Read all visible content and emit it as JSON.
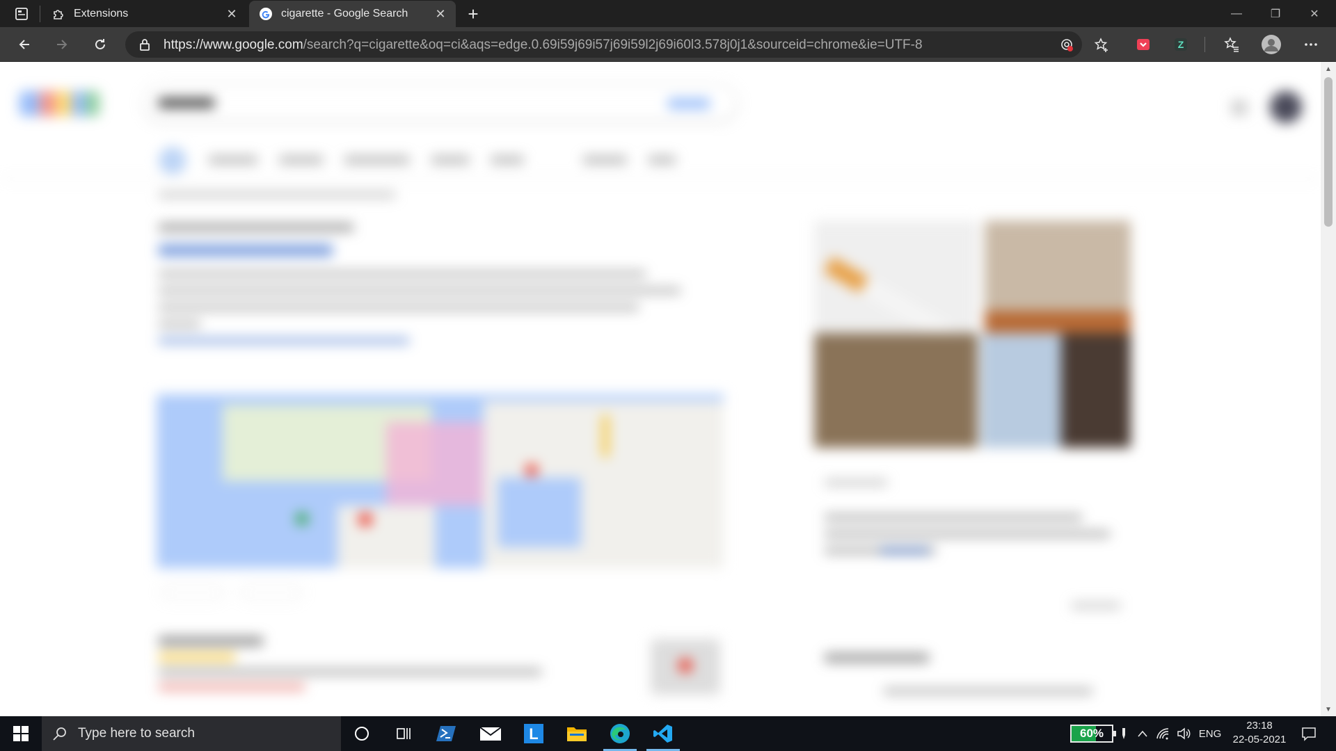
{
  "tabs": [
    {
      "title": "Extensions",
      "icon": "puzzle-icon",
      "active": false
    },
    {
      "title": "cigarette - Google Search",
      "icon": "google-g-icon",
      "active": true
    }
  ],
  "omnibox": {
    "url_host": "https://www.google.com",
    "url_path": "/search?q=cigarette&oq=ci&aqs=edge.0.69i59j69i57j69i59l2j69i60l3.578j0j1&sourceid=chrome&ie=UTF-8"
  },
  "taskbar": {
    "search_placeholder": "Type here to search",
    "battery_level": 60,
    "battery_label": "60%",
    "language": "ENG",
    "time": "23:18",
    "date": "22-05-2021",
    "pinned_apps": [
      "cortana-icon",
      "task-view-icon",
      "powershell-icon",
      "mail-icon",
      "l-app-icon",
      "file-explorer-icon",
      "edge-icon",
      "vscode-icon"
    ]
  },
  "colors": {
    "tab_bg": "#202020",
    "toolbar_bg": "#3b3b3b",
    "taskbar_bg": "#0f1218",
    "battery_fill": "#1aa34a",
    "accent": "#76b9ed"
  }
}
